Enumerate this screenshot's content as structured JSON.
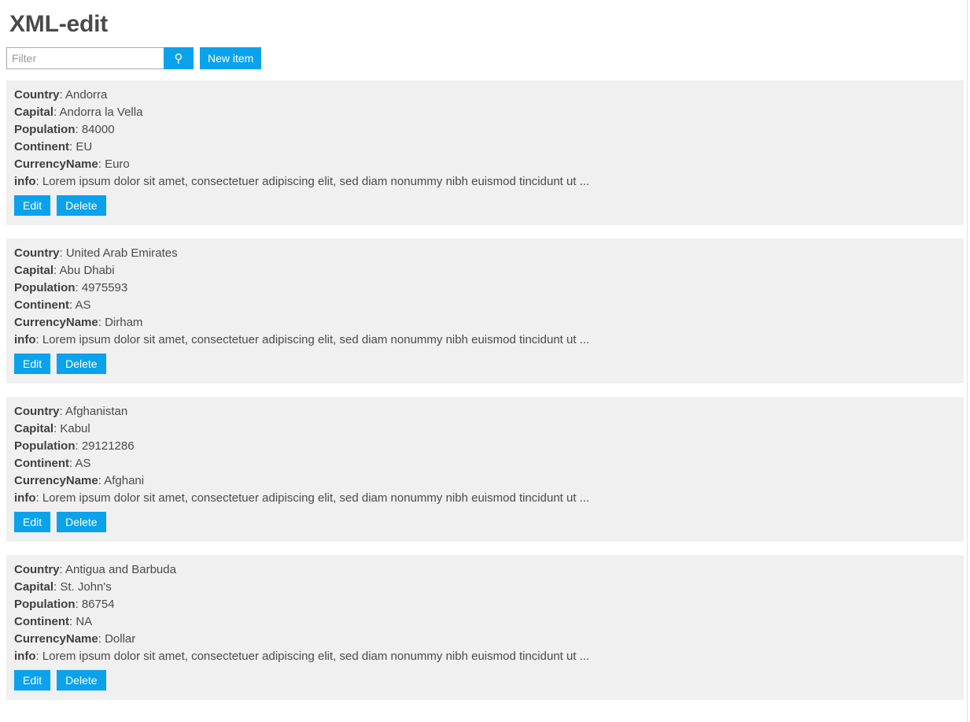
{
  "app": {
    "title": "XML-edit",
    "accent_color": "#0aa2ec",
    "card_bg": "#f0f0f0",
    "text_color": "#4a4a4a"
  },
  "toolbar": {
    "filter_placeholder": "Filter",
    "filter_value": "",
    "search_icon": "search-icon",
    "search_glyph": "⚲",
    "new_item_label": "New item"
  },
  "field_labels": {
    "country": "Country",
    "capital": "Capital",
    "population": "Population",
    "continent": "Continent",
    "currency_name": "CurrencyName",
    "info": "info"
  },
  "actions": {
    "edit_label": "Edit",
    "delete_label": "Delete"
  },
  "items": [
    {
      "country": "Andorra",
      "capital": "Andorra la Vella",
      "population": "84000",
      "continent": "EU",
      "currency_name": "Euro",
      "info": "Lorem ipsum dolor sit amet, consectetuer adipiscing elit, sed diam nonummy nibh euismod tincidunt ut ..."
    },
    {
      "country": "United Arab Emirates",
      "capital": "Abu Dhabi",
      "population": "4975593",
      "continent": "AS",
      "currency_name": "Dirham",
      "info": "Lorem ipsum dolor sit amet, consectetuer adipiscing elit, sed diam nonummy nibh euismod tincidunt ut ..."
    },
    {
      "country": "Afghanistan",
      "capital": "Kabul",
      "population": "29121286",
      "continent": "AS",
      "currency_name": "Afghani",
      "info": "Lorem ipsum dolor sit amet, consectetuer adipiscing elit, sed diam nonummy nibh euismod tincidunt ut ..."
    },
    {
      "country": "Antigua and Barbuda",
      "capital": "St. John's",
      "population": "86754",
      "continent": "NA",
      "currency_name": "Dollar",
      "info": "Lorem ipsum dolor sit amet, consectetuer adipiscing elit, sed diam nonummy nibh euismod tincidunt ut ..."
    }
  ]
}
